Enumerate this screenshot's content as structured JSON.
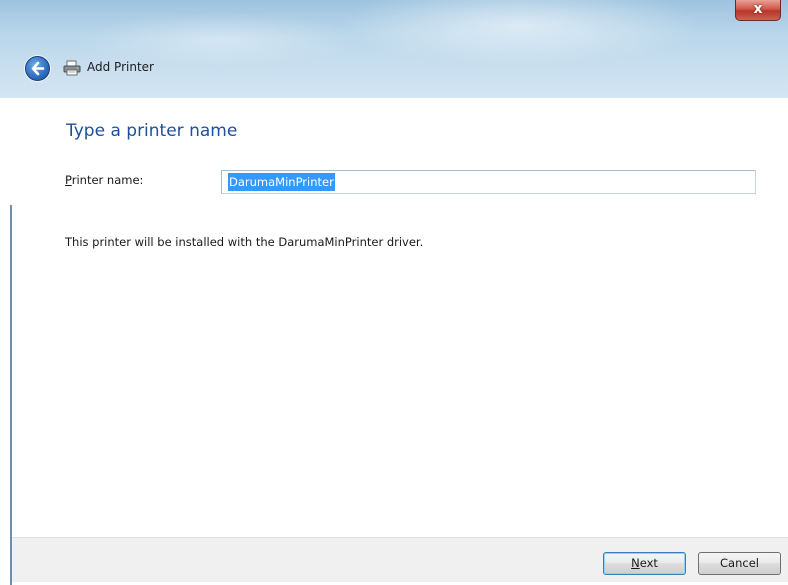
{
  "window": {
    "title": "Add Printer",
    "close_glyph": "x"
  },
  "icons": {
    "back": "back-arrow-icon",
    "printer": "printer-icon"
  },
  "page": {
    "heading": "Type a printer name",
    "printer_name_label_accel": "P",
    "printer_name_label_rest": "rinter name:",
    "printer_name_value": "DarumaMinPrinter",
    "note": "This printer will be installed with the DarumaMinPrinter driver."
  },
  "footer": {
    "next_accel": "N",
    "next_rest": "ext",
    "cancel_label": "Cancel"
  },
  "colors": {
    "heading": "#1e4f9c",
    "selection": "#3399ff",
    "close_button": "#c9453a"
  }
}
